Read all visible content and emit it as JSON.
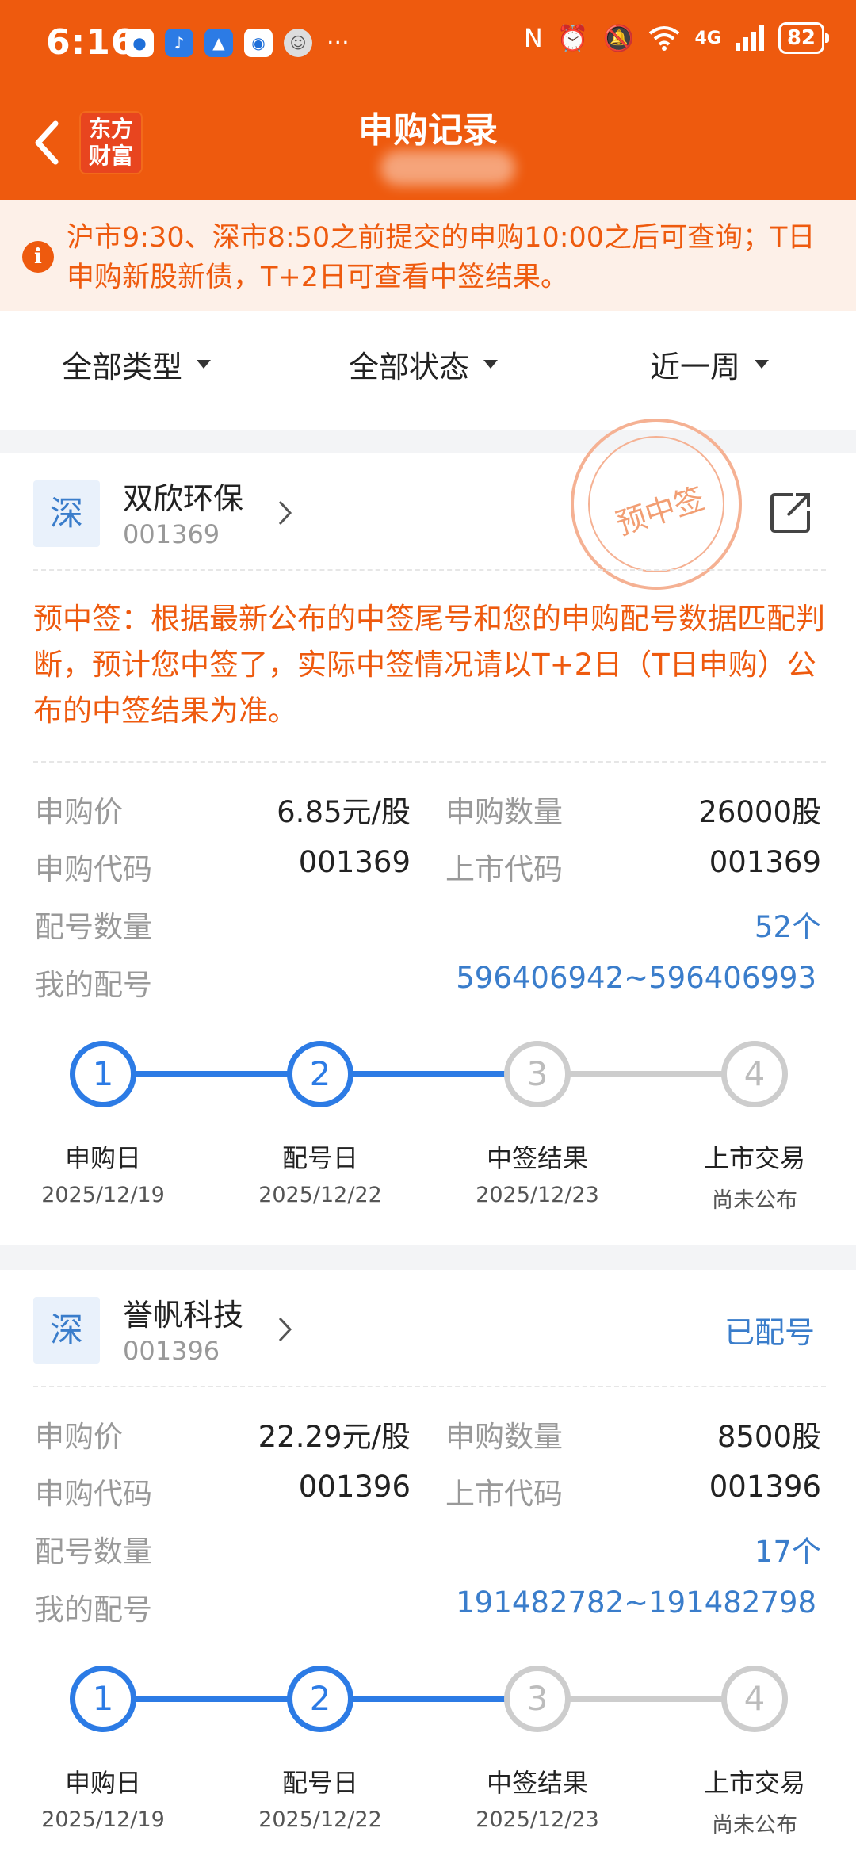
{
  "status_bar": {
    "time": "6:16",
    "battery": "82",
    "more": "···",
    "network": "4G"
  },
  "header": {
    "title": "申购记录",
    "logo_text_1": "东方",
    "logo_text_2": "财富"
  },
  "notice": {
    "text": "沪市9:30、深市8:50之前提交的申购10:00之后可查询；T日申购新股新债，T+2日可查看中签结果。"
  },
  "filters": [
    {
      "label": "全部类型"
    },
    {
      "label": "全部状态"
    },
    {
      "label": "近一周"
    }
  ],
  "labels": {
    "price": "申购价",
    "qty": "申购数量",
    "sub_code": "申购代码",
    "list_code": "上市代码",
    "lot_count": "配号数量",
    "my_lots": "我的配号"
  },
  "steps": [
    {
      "num": "1",
      "name": "申购日"
    },
    {
      "num": "2",
      "name": "配号日"
    },
    {
      "num": "3",
      "name": "中签结果"
    },
    {
      "num": "4",
      "name": "上市交易"
    }
  ],
  "records": [
    {
      "market": "深",
      "name": "双欣环保",
      "code": "001369",
      "stamp": "预中签",
      "warning": "预中签：根据最新公布的中签尾号和您的申购配号数据匹配判断，预计您中签了，实际中签情况请以T+2日（T日申购）公布的中签结果为准。",
      "price": "6.85元/股",
      "qty": "26000股",
      "sub_code": "001369",
      "list_code": "001369",
      "lot_count": "52个",
      "my_lots": "596406942~596406993",
      "dates": [
        "2025/12/19",
        "2025/12/22",
        "2025/12/23",
        "尚未公布"
      ],
      "completed_steps": 2
    },
    {
      "market": "深",
      "name": "誉帆科技",
      "code": "001396",
      "status": "已配号",
      "price": "22.29元/股",
      "qty": "8500股",
      "sub_code": "001396",
      "list_code": "001396",
      "lot_count": "17个",
      "my_lots": "191482782~191482798",
      "dates": [
        "2025/12/19",
        "2025/12/22",
        "2025/12/23",
        "尚未公布"
      ],
      "completed_steps": 2
    }
  ]
}
